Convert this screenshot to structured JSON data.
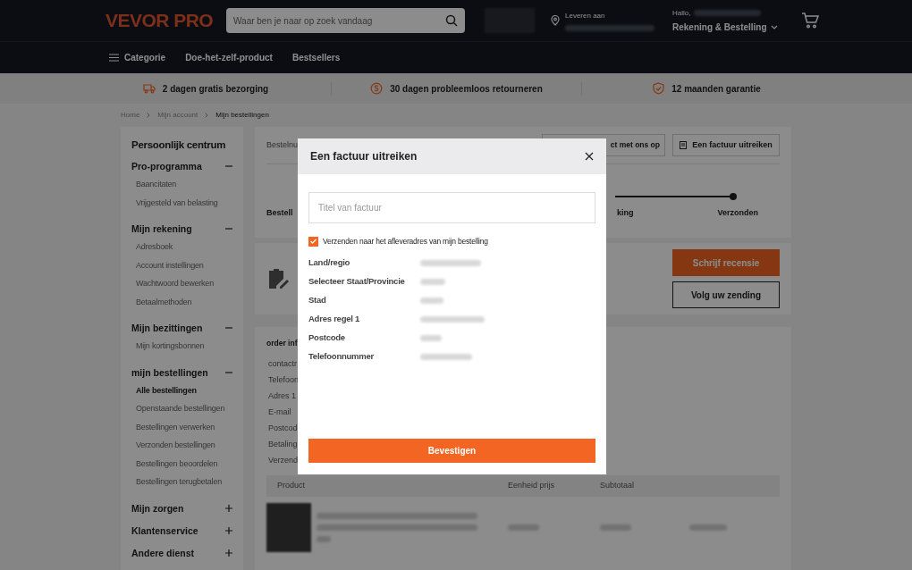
{
  "header": {
    "logo": "VEVOR PRO",
    "search": {
      "placeholder": "Waar ben je naar op zoek vandaag"
    },
    "delivery_label": "Leveren aan",
    "greeting": "Hallo,",
    "account": "Rekening & Bestelling"
  },
  "nav": {
    "menu_label": "Categorie",
    "links": [
      "Doe-het-zelf-product",
      "Bestsellers"
    ]
  },
  "benefits": [
    {
      "kind": "truck",
      "text": "2 dagen gratis bezorging"
    },
    {
      "kind": "refund",
      "text": "30 dagen probleemloos retourneren"
    },
    {
      "kind": "shield",
      "text": "12 maanden garantie"
    }
  ],
  "breadcrumb": [
    "Home",
    "Mijn account",
    "Mijn bestellingen"
  ],
  "sidebar": {
    "title": "Persoonlijk centrum",
    "sections": [
      {
        "title": "Pro-programma",
        "expanded": true,
        "items": [
          {
            "label": "Baancitaten",
            "selected": false
          },
          {
            "label": "Vrijgesteld van belasting",
            "selected": false
          }
        ]
      },
      {
        "title": "Mijn rekening",
        "expanded": true,
        "items": [
          {
            "label": "Adresboek",
            "selected": false
          },
          {
            "label": "Account instellingen",
            "selected": false
          },
          {
            "label": "Wachtwoord bewerken",
            "selected": false
          },
          {
            "label": "Betaalmethoden",
            "selected": false
          }
        ]
      },
      {
        "title": "Mijn bezittingen",
        "expanded": true,
        "items": [
          {
            "label": "Mijn kortingsbonnen",
            "selected": false
          }
        ]
      },
      {
        "title": "mijn bestellingen",
        "expanded": true,
        "items": [
          {
            "label": "Alle bestellingen",
            "selected": true
          },
          {
            "label": "Openstaande bestellingen",
            "selected": false
          },
          {
            "label": "Bestellingen verwerken",
            "selected": false
          },
          {
            "label": "Verzonden bestellingen",
            "selected": false
          },
          {
            "label": "Bestellingen beoordelen",
            "selected": false
          },
          {
            "label": "Bestellingen terugbetalen",
            "selected": false
          }
        ]
      },
      {
        "title": "Mijn zorgen",
        "expanded": false
      },
      {
        "title": "Klantenservice",
        "expanded": false
      },
      {
        "title": "Andere dienst",
        "expanded": false
      }
    ]
  },
  "order_card": {
    "number_label": "Bestelnu",
    "contact_button": "ct met ons op",
    "invoice_button": "Een factuur uitreiken",
    "steps": [
      "Bestell",
      "king",
      "Verzonden"
    ]
  },
  "review_card": {
    "buttons": [
      {
        "kind": "primary",
        "label": "Schrijf recensie"
      },
      {
        "kind": "outline",
        "label": "Volg uw zending"
      }
    ]
  },
  "order_info": {
    "title": "order inf",
    "fields": [
      "contactr",
      "Telefoon",
      "Adres 1",
      "E-mail",
      "Postcod",
      "Betaling",
      "Verzendi"
    ],
    "columns": [
      "Product",
      "Eenheid prijs",
      "Subtotaal"
    ]
  },
  "modal": {
    "title": "Een factuur uitreiken",
    "title_field": {
      "placeholder": "Titel van factuur"
    },
    "checkbox": {
      "label": "Verzenden naar het afleveradres van mijn bestelling",
      "checked": true
    },
    "fields": [
      "Land/regio",
      "Selecteer Staat/Provincie",
      "Stad",
      "Adres regel 1",
      "Postcode",
      "Telefoonnummer"
    ],
    "confirm": "Bevestigen"
  }
}
